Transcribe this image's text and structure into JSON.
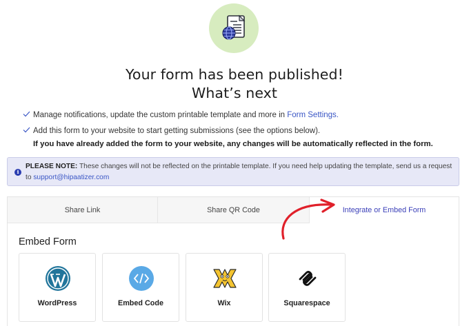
{
  "header": {
    "title_line1": "Your form has been published!",
    "title_line2": "What’s next"
  },
  "checklist": {
    "item1_text": "Manage notifications, update the custom printable template and more in ",
    "item1_link": "Form Settings.",
    "item2_text": "Add this form to your website to start getting submissions (see the options below).",
    "item2_bold": "If you have already added the form to your website, any changes will be automatically reflected in the form."
  },
  "note": {
    "label": "PLEASE NOTE:",
    "text": " These changes will not be reflected on the printable template. If you need help updating the template, send us a request to ",
    "email": "support@hipaatizer.com"
  },
  "tabs": [
    {
      "label": "Share Link"
    },
    {
      "label": "Share QR Code"
    },
    {
      "label": "Integrate or Embed Form"
    }
  ],
  "embed": {
    "title": "Embed Form",
    "options": [
      {
        "label": "WordPress",
        "icon": "wordpress-icon"
      },
      {
        "label": "Embed Code",
        "icon": "code-icon"
      },
      {
        "label": "Wix",
        "icon": "wix-icon"
      },
      {
        "label": "Squarespace",
        "icon": "squarespace-icon"
      }
    ]
  },
  "colors": {
    "accent": "#3a3fb8",
    "link": "#3a56c5",
    "hero_circle": "#d7ecbf",
    "annotation_arrow": "#e0202a"
  }
}
